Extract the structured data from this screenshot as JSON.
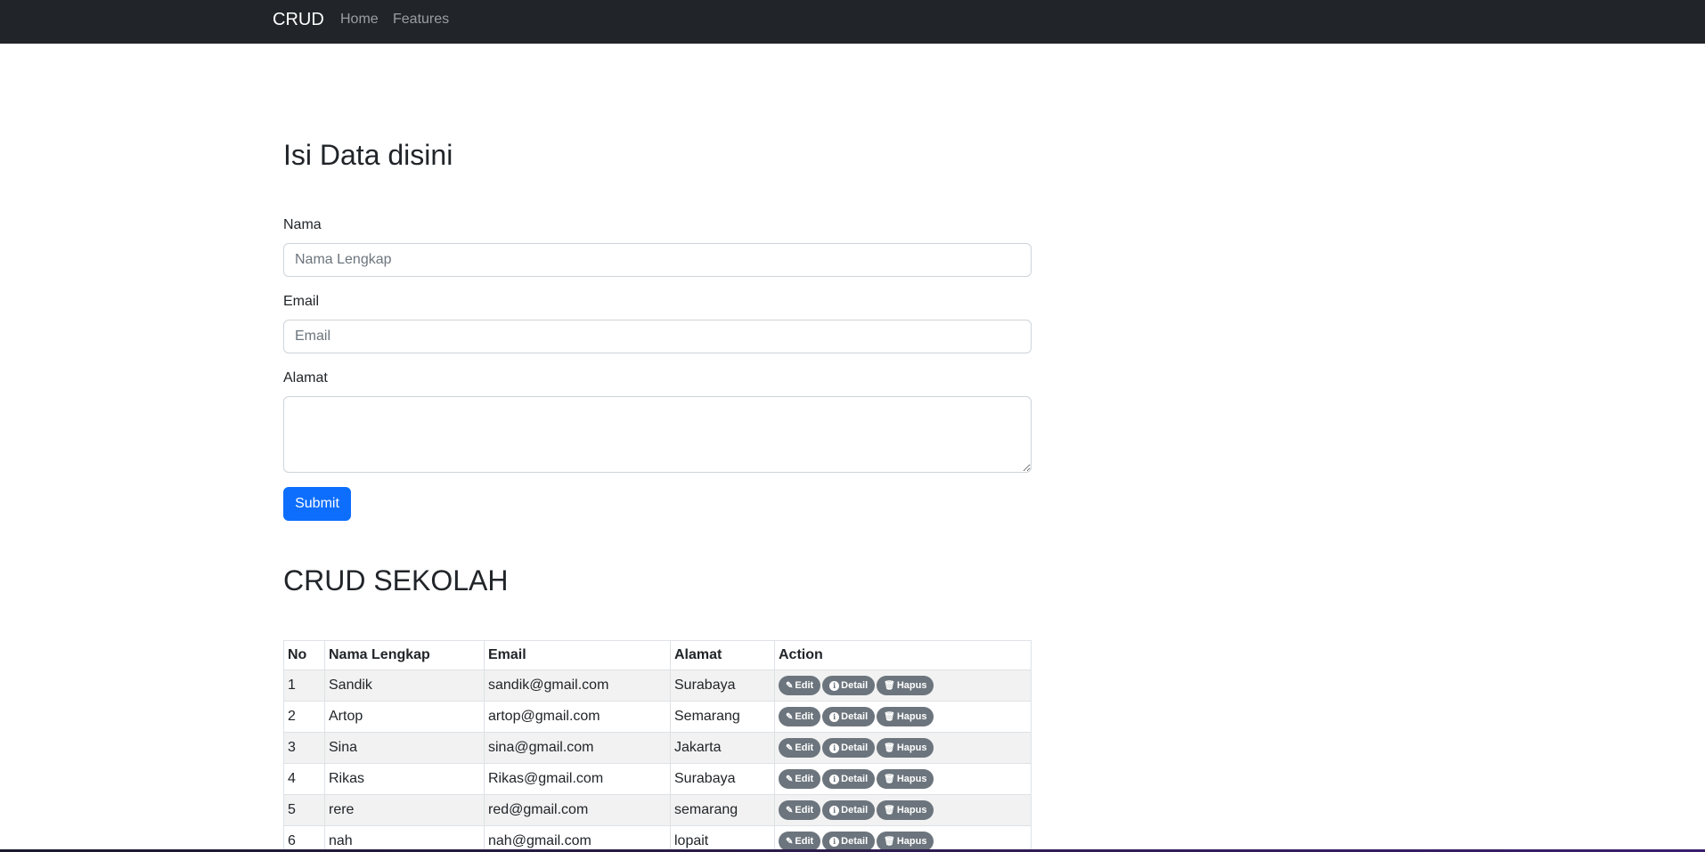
{
  "navbar": {
    "brand": "CRUD",
    "links": [
      "Home",
      "Features"
    ]
  },
  "form": {
    "title": "Isi Data disini",
    "nama_label": "Nama",
    "nama_placeholder": "Nama Lengkap",
    "email_label": "Email",
    "email_placeholder": "Email",
    "alamat_label": "Alamat",
    "submit_label": "Submit"
  },
  "table": {
    "title": "CRUD SEKOLAH",
    "headers": [
      "No",
      "Nama Lengkap",
      "Email",
      "Alamat",
      "Action"
    ],
    "actions": [
      "Edit",
      "Detail",
      "Hapus"
    ],
    "rows": [
      {
        "no": "1",
        "nama": "Sandik",
        "email": "sandik@gmail.com",
        "alamat": "Surabaya"
      },
      {
        "no": "2",
        "nama": "Artop",
        "email": "artop@gmail.com",
        "alamat": "Semarang"
      },
      {
        "no": "3",
        "nama": "Sina",
        "email": "sina@gmail.com",
        "alamat": "Jakarta"
      },
      {
        "no": "4",
        "nama": "Rikas",
        "email": "Rikas@gmail.com",
        "alamat": "Surabaya"
      },
      {
        "no": "5",
        "nama": "rere",
        "email": "red@gmail.com",
        "alamat": "semarang"
      },
      {
        "no": "6",
        "nama": "nah",
        "email": "nah@gmail.com",
        "alamat": "lopait"
      }
    ]
  },
  "icons": {
    "edit": "edit-icon",
    "detail": "info-icon",
    "hapus": "trash-icon"
  },
  "colors": {
    "navbar_bg": "#212529",
    "primary": "#0d6efd",
    "secondary_badge": "#6c757d"
  }
}
